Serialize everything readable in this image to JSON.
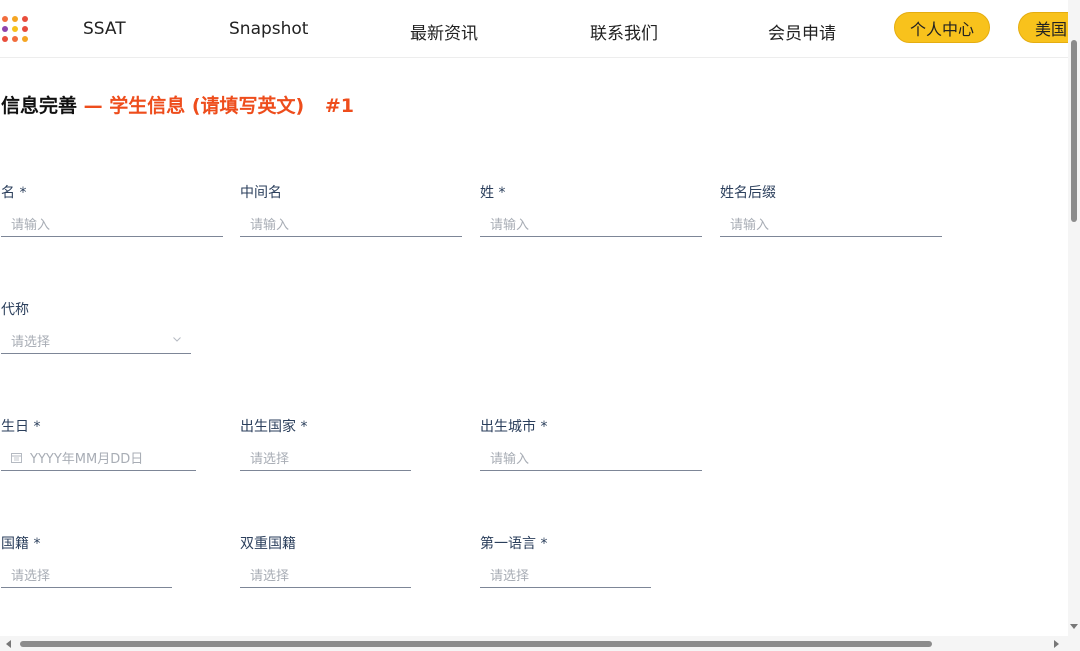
{
  "nav": {
    "logo_icon": "dot-grid-logo-icon",
    "links": [
      "SSAT",
      "Snapshot",
      "最新资讯",
      "联系我们",
      "会员申请"
    ],
    "personal_center": "个人中心",
    "region": "美国",
    "pill_color": "#f8c21c"
  },
  "title": {
    "part1": "信息完善",
    "part2": "— 学生信息 (请填写英文)",
    "part3": "#1",
    "accent_color": "#ee4d1c"
  },
  "form": {
    "first_name": {
      "label": "名 *",
      "placeholder": "请输入"
    },
    "middle_name": {
      "label": "中间名",
      "placeholder": "请输入"
    },
    "last_name": {
      "label": "姓 *",
      "placeholder": "请输入"
    },
    "suffix": {
      "label": "姓名后缀",
      "placeholder": "请输入"
    },
    "pronoun": {
      "label": "代称",
      "placeholder": "请选择",
      "icon": "chevron-down-icon"
    },
    "birthday": {
      "label": "生日 *",
      "placeholder": "YYYY年MM月DD日",
      "icon": "calendar-icon"
    },
    "birth_country": {
      "label": "出生国家 *",
      "placeholder": "请选择"
    },
    "birth_city": {
      "label": "出生城市 *",
      "placeholder": "请输入"
    },
    "nationality": {
      "label": "国籍 *",
      "placeholder": "请选择"
    },
    "dual_nationality": {
      "label": "双重国籍",
      "placeholder": "请选择"
    },
    "first_language": {
      "label": "第一语言 *",
      "placeholder": "请选择"
    }
  }
}
